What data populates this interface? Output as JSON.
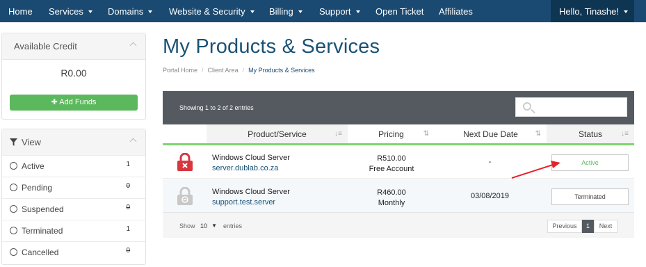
{
  "navbar": {
    "items": [
      {
        "label": "Home",
        "dropdown": false
      },
      {
        "label": "Services",
        "dropdown": true
      },
      {
        "label": "Domains",
        "dropdown": true
      },
      {
        "label": "Website & Security",
        "dropdown": true
      },
      {
        "label": "Billing",
        "dropdown": true
      },
      {
        "label": "Support",
        "dropdown": true
      },
      {
        "label": "Open Ticket",
        "dropdown": false
      },
      {
        "label": "Affiliates",
        "dropdown": false
      }
    ],
    "user_label": "Hello, Tinashe!"
  },
  "sidebar": {
    "credit": {
      "title": "Available Credit",
      "amount": "R0.00",
      "add_funds_label": "Add Funds"
    },
    "view": {
      "title": "View",
      "items": [
        {
          "label": "Active",
          "count": "1"
        },
        {
          "label": "Pending",
          "count": "0"
        },
        {
          "label": "Suspended",
          "count": "0"
        },
        {
          "label": "Terminated",
          "count": "1"
        },
        {
          "label": "Cancelled",
          "count": "0"
        }
      ]
    }
  },
  "main": {
    "title": "My Products & Services",
    "breadcrumb": [
      "Portal Home",
      "Client Area",
      "My Products & Services"
    ],
    "table": {
      "showing": "Showing 1 to 2 of 2 entries",
      "search_placeholder": "",
      "columns": [
        "Product/Service",
        "Pricing",
        "Next Due Date",
        "Status"
      ],
      "rows": [
        {
          "product": "Windows Cloud Server",
          "domain": "server.dublab.co.za",
          "price": "R510.00",
          "cycle": "Free Account",
          "due": "-",
          "status": "Active",
          "status_color": "#5cb85c",
          "lock_color": "#d9363e"
        },
        {
          "product": "Windows Cloud Server",
          "domain": "support.test.server",
          "price": "R460.00",
          "cycle": "Monthly",
          "due": "03/08/2019",
          "status": "Terminated",
          "status_color": "#444444",
          "lock_color": "#c8c8c8"
        }
      ],
      "show_label": "Show",
      "page_size": "10",
      "entries_label": "entries",
      "pagination": {
        "previous": "Previous",
        "current": "1",
        "next": "Next"
      }
    }
  },
  "colors": {
    "navbar": "#1a4a72",
    "accent_green": "#5cb85c",
    "title_blue": "#1a5276",
    "annotation_arrow": "#e8222a"
  }
}
